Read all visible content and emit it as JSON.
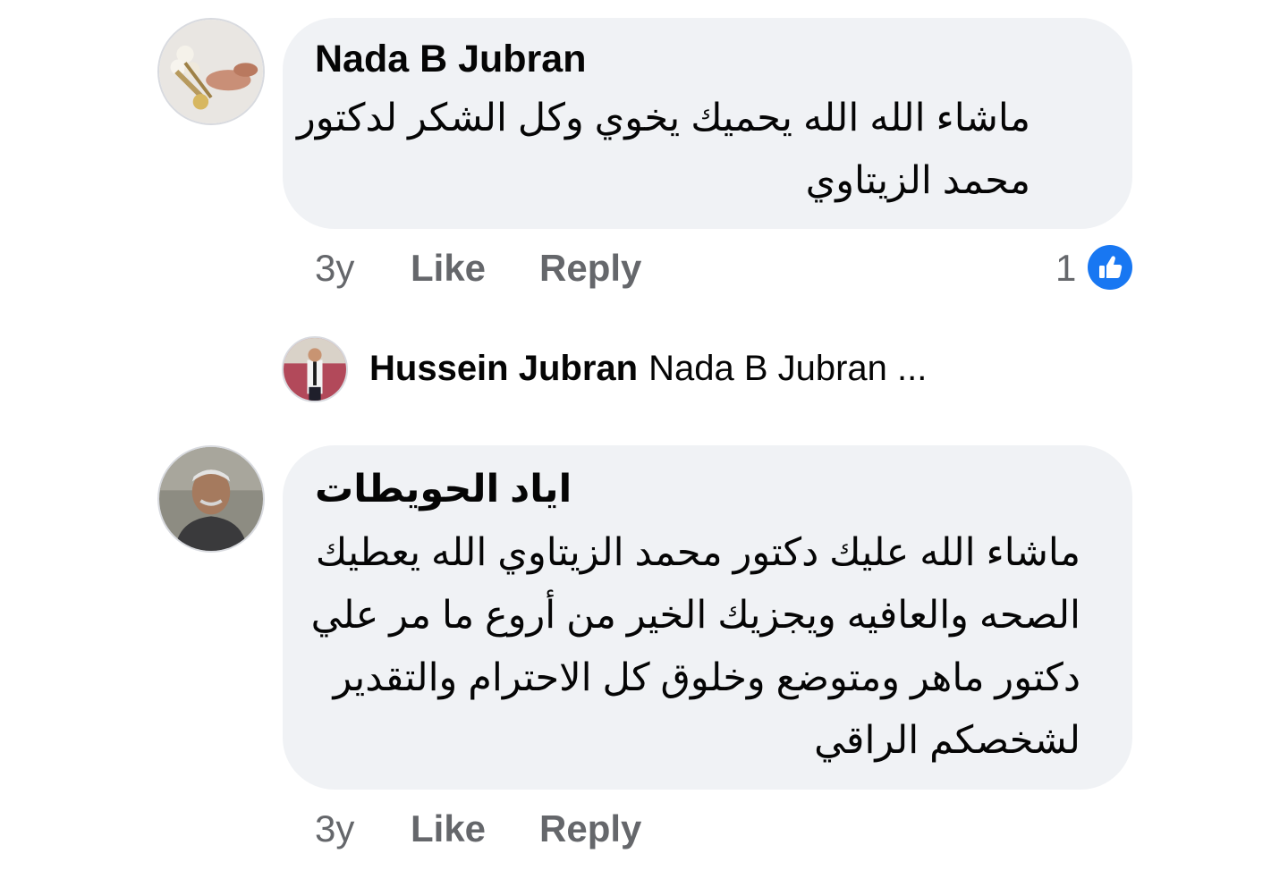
{
  "comments": [
    {
      "author": "Nada B Jubran",
      "text_lines": [
        "ماشاء الله الله يحميك يخوي وكل الشكر لدكتور",
        "محمد الزيتاوي"
      ],
      "time": "3y",
      "like_label": "Like",
      "reply_label": "Reply",
      "reaction_count": "1",
      "reaction_icon": "like-thumb-icon",
      "reply_preview": {
        "author": "Hussein Jubran",
        "preview": "Nada B Jubran ..."
      }
    },
    {
      "author": "اياد الحويطات",
      "text_lines": [
        "ماشاء الله عليك دكتور محمد الزيتاوي الله يعطيك",
        "الصحه والعافيه ويجزيك الخير من أروع ما مر علي",
        "دكتور ماهر ومتوضع وخلوق كل الاحترام والتقدير",
        "لشخصكم الراقي"
      ],
      "time": "3y",
      "like_label": "Like",
      "reply_label": "Reply"
    }
  ],
  "colors": {
    "bubble": "#f0f2f5",
    "text": "#050505",
    "meta": "#65676b",
    "like_blue": "#1877f2"
  }
}
